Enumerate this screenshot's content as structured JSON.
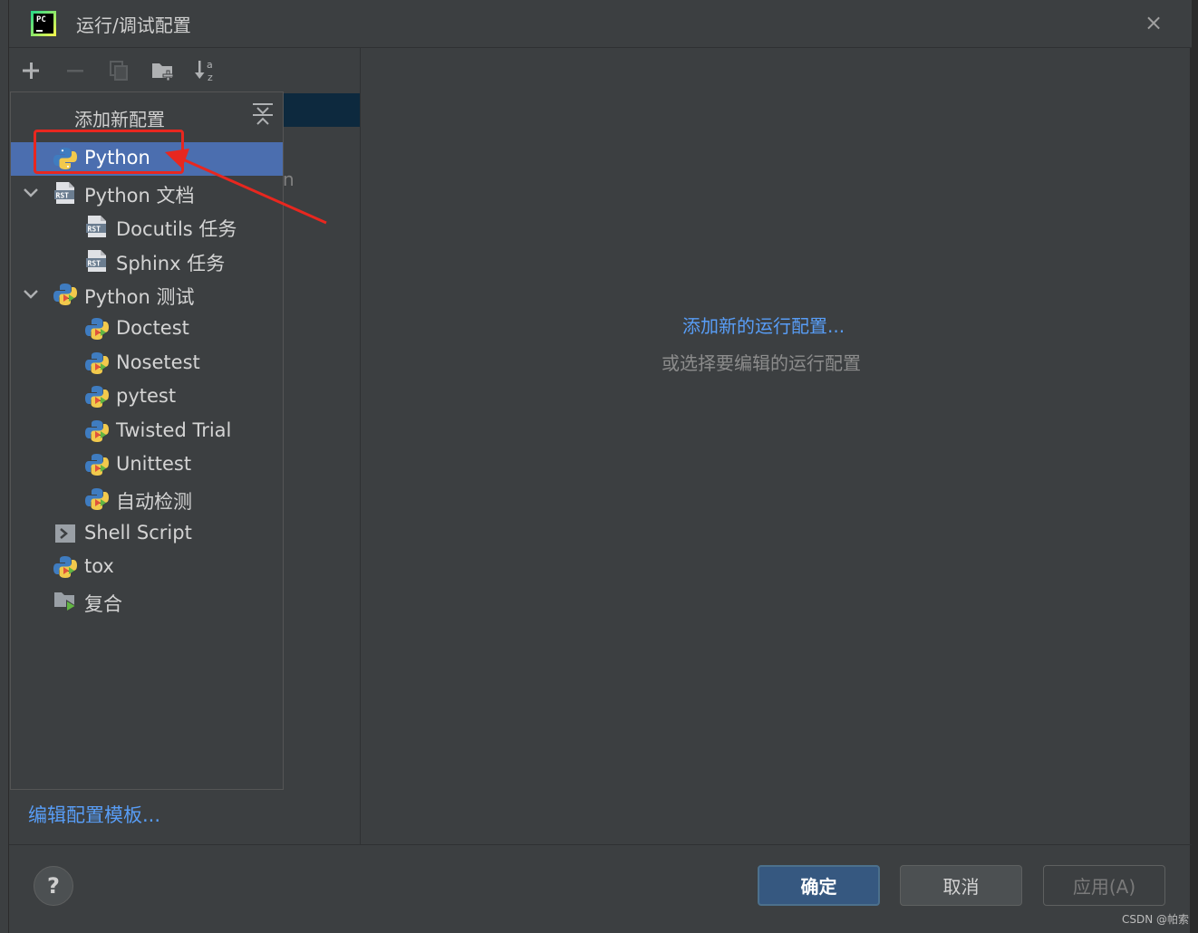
{
  "window": {
    "title": "运行/调试配置",
    "close_glyph": "×"
  },
  "toolbar": {
    "buttons": [
      {
        "name": "add-icon",
        "enabled": true
      },
      {
        "name": "remove-icon",
        "enabled": false
      },
      {
        "name": "copy-icon",
        "enabled": false
      },
      {
        "name": "new-folder-icon",
        "enabled": true
      },
      {
        "name": "sort-icon",
        "enabled": true
      }
    ]
  },
  "popup": {
    "header": "添加新配置",
    "items": [
      {
        "label": "Python",
        "icon": "python-icon",
        "level": 0,
        "selected": true
      },
      {
        "label": "Python 文档",
        "icon": "rst-icon",
        "level": 0,
        "expanded": true
      },
      {
        "label": "Docutils 任务",
        "icon": "rst-icon",
        "level": 1
      },
      {
        "label": "Sphinx 任务",
        "icon": "rst-icon",
        "level": 1
      },
      {
        "label": "Python 测试",
        "icon": "python-test-icon",
        "level": 0,
        "expanded": true
      },
      {
        "label": "Doctest",
        "icon": "python-test-icon",
        "level": 1
      },
      {
        "label": "Nosetest",
        "icon": "python-test-icon",
        "level": 1
      },
      {
        "label": "pytest",
        "icon": "python-test-icon",
        "level": 1
      },
      {
        "label": "Twisted Trial",
        "icon": "python-test-icon",
        "level": 1
      },
      {
        "label": "Unittest",
        "icon": "python-test-icon",
        "level": 1
      },
      {
        "label": "自动检测",
        "icon": "python-test-icon",
        "level": 1
      },
      {
        "label": "Shell Script",
        "icon": "shell-icon",
        "level": 0
      },
      {
        "label": "tox",
        "icon": "python-test-icon",
        "level": 0
      },
      {
        "label": "复合",
        "icon": "compound-icon",
        "level": 0
      }
    ]
  },
  "background_fragment": "n",
  "edit_templates_link": "编辑配置模板...",
  "empty_state": {
    "link": "添加新的运行配置...",
    "hint": "或选择要编辑的运行配置"
  },
  "footer": {
    "help": "?",
    "ok": "确定",
    "cancel": "取消",
    "apply": "应用(A)"
  },
  "watermark": "CSDN @帕索",
  "colors": {
    "selection": "#4b6eaf",
    "link": "#589df6",
    "annotation": "#e8271f"
  }
}
